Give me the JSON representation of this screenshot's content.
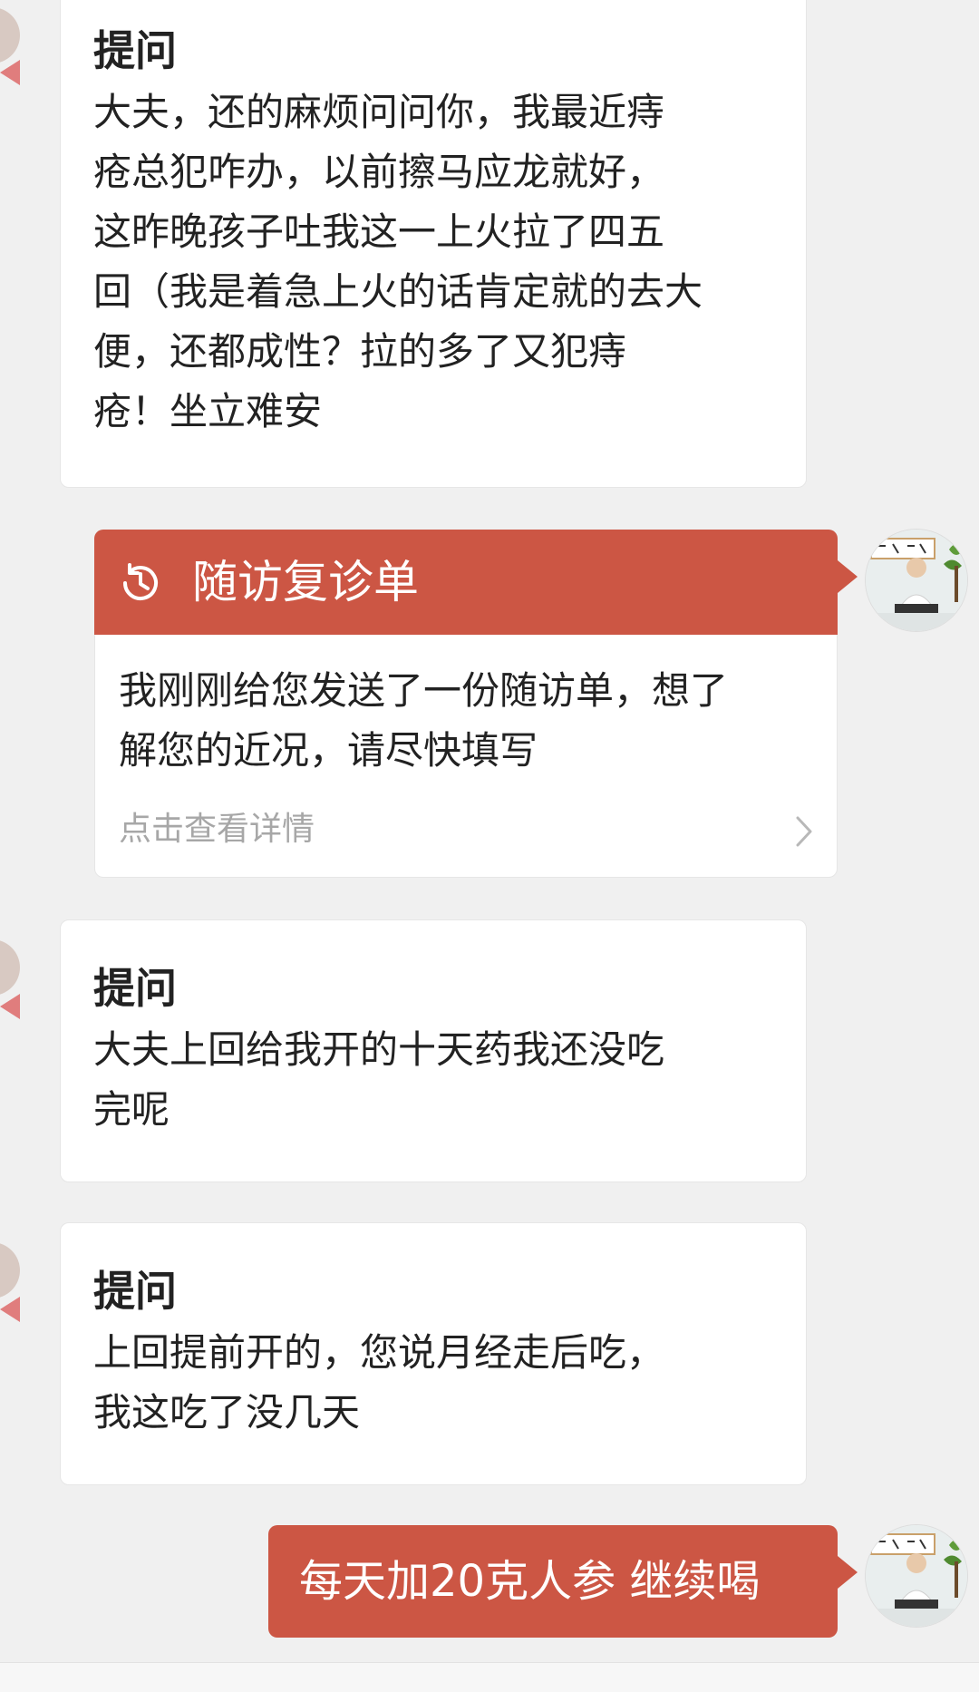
{
  "messages": [
    {
      "title": "提问",
      "lines": [
        "大夫，还的麻烦问问你，我最近痔",
        "疮总犯咋办，以前擦马应龙就好，",
        "这昨晚孩子吐我这一上火拉了四五",
        "回（我是着急上火的话肯定就的去大",
        "便，还都成性？拉的多了又犯痔",
        "疮！坐立难安"
      ]
    },
    {
      "title": "提问",
      "lines": [
        "大夫上回给我开的十天药我还没吃",
        "完呢"
      ]
    },
    {
      "title": "提问",
      "lines": [
        "上回提前开的，您说月经走后吃，",
        "我这吃了没几天"
      ]
    }
  ],
  "followup": {
    "icon": "clock-history-icon",
    "title": "随访复诊单",
    "lines": [
      "我刚刚给您发送了一份随访单，想了",
      "解您的近况，请尽快填写"
    ],
    "link": "点击查看详情"
  },
  "reply": {
    "text": "每天加20克人参 继续喝"
  },
  "colors": {
    "accent": "#cc5644",
    "background": "#f0f0f0",
    "card": "#ffffff"
  }
}
